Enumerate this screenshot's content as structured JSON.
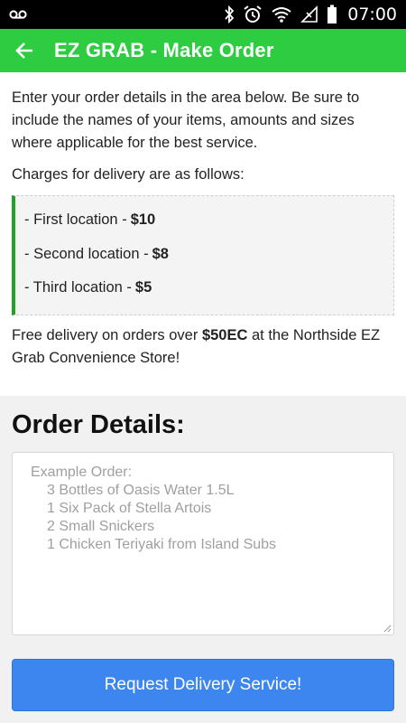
{
  "status_bar": {
    "time": "07:00",
    "icons": [
      "voicemail-icon",
      "bluetooth-icon",
      "alarm-icon",
      "wifi-icon",
      "no-signal-icon",
      "battery-icon"
    ]
  },
  "app_bar": {
    "title": "EZ GRAB - Make Order",
    "back_icon": "arrow-left-icon",
    "color": "#2ecc40"
  },
  "intro": "Enter your order details in the area below. Be sure to include the names of your items, amounts and sizes where applicable for the best service.",
  "charges": {
    "heading": "Charges for delivery are as follows:",
    "items": [
      {
        "label": "- First location -",
        "price": "$10"
      },
      {
        "label": "- Second location -",
        "price": "$8"
      },
      {
        "label": "- Third location -",
        "price": "$5"
      }
    ]
  },
  "free_delivery": {
    "prefix": "Free delivery on orders over",
    "amount": "$50EC",
    "suffix": "at the Northside EZ Grab Convenience Store!"
  },
  "order_details": {
    "heading": "Order Details:",
    "placeholder_lines": [
      "Example Order:",
      "3 Bottles of Oasis Water 1.5L",
      "1 Six Pack of Stella Artois",
      "2 Small Snickers",
      "1 Chicken Teriyaki from Island Subs"
    ]
  },
  "submit_button": {
    "label": "Request Delivery Service!",
    "color": "#3d86f0"
  }
}
